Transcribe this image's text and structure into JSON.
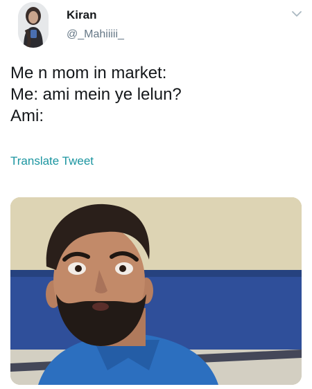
{
  "user": {
    "display_name": "Kiran",
    "handle": "@_Mahiiiii_"
  },
  "tweet": {
    "lines": [
      "Me n mom in market:",
      "Me: ami mein ye lelun?",
      "Ami:"
    ],
    "translate_label": "Translate Tweet"
  },
  "icons": {
    "menu": "chevron-down-icon"
  },
  "colors": {
    "text": "#14171a",
    "secondary": "#657786",
    "link": "#1b95a0"
  }
}
